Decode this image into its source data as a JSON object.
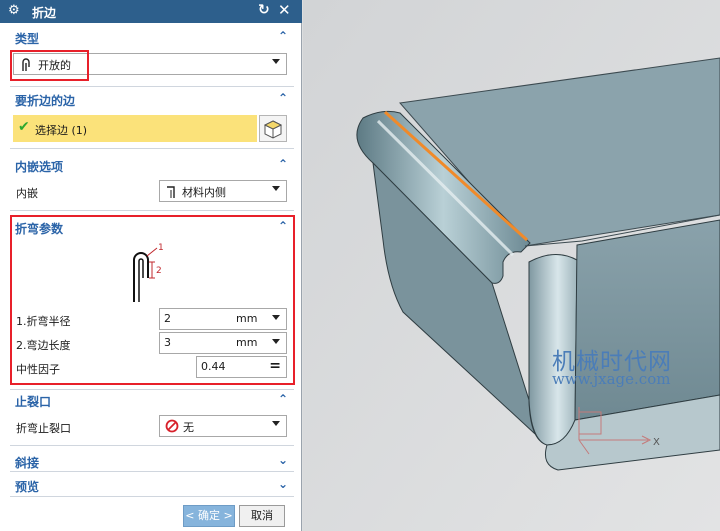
{
  "dialog": {
    "title": "折边",
    "icons": {
      "settings": "gear-icon",
      "reset": "reset-icon",
      "close": "close-icon"
    }
  },
  "type_section": {
    "title": "类型",
    "selected": "开放的"
  },
  "edge_section": {
    "title": "要折边的边",
    "select_label": "选择边 (1)"
  },
  "inset_section": {
    "title": "内嵌选项",
    "label": "内嵌",
    "selected": "材料内侧"
  },
  "bend_section": {
    "title": "折弯参数",
    "diagram_labels": {
      "one": "1",
      "two": "2"
    },
    "radius_label": "1.折弯半径",
    "radius_value": "2",
    "radius_unit": "mm",
    "length_label": "2.弯边长度",
    "length_value": "3",
    "length_unit": "mm",
    "kfactor_label": "中性因子",
    "kfactor_value": "0.44",
    "kfactor_symbol": "="
  },
  "relief_section": {
    "title": "止裂口",
    "label": "折弯止裂口",
    "selected": "无"
  },
  "miter_section": {
    "title": "斜接"
  },
  "preview_section": {
    "title": "预览"
  },
  "buttons": {
    "ok": "< 确定 >",
    "cancel": "取消"
  },
  "viewport": {
    "axis_label": "X",
    "watermark_cn": "机械时代网",
    "watermark_url": "www.jxage.com"
  },
  "colors": {
    "title_bar": "#2d5f8c",
    "section_title": "#2b64a8",
    "highlight": "#e8202a",
    "selection_fill": "#fbe27a"
  }
}
